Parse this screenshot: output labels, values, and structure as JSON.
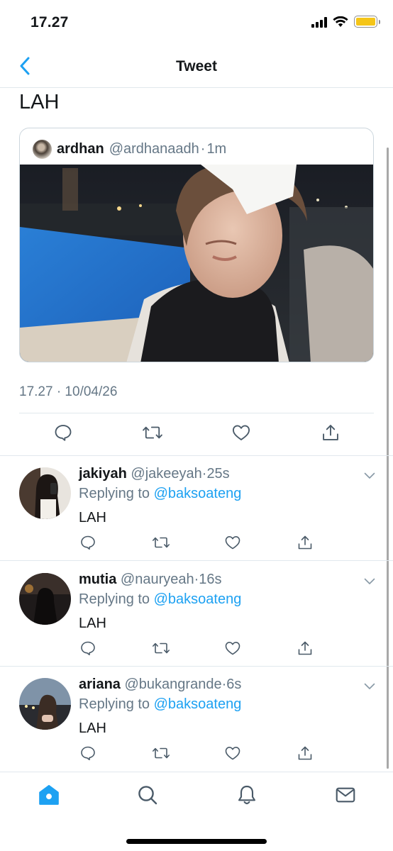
{
  "status_bar": {
    "time": "17.27"
  },
  "nav": {
    "title": "Tweet"
  },
  "tweet": {
    "text": "LAH",
    "quoted": {
      "name": "ardhan",
      "handle": "@ardhanaadh",
      "separator": "·",
      "time": "1m"
    },
    "timestamp": "17.27 · 10/04/26"
  },
  "icons": {
    "reply": "reply-icon",
    "retweet": "retweet-icon",
    "like": "heart-icon",
    "share": "share-icon"
  },
  "replies": [
    {
      "name": "jakiyah",
      "handle": "@jakeeyah",
      "separator": "·",
      "time": "25s",
      "replying_prefix": "Replying to ",
      "replying_to": "@baksoateng",
      "text": "LAH"
    },
    {
      "name": "mutia",
      "handle": "@nauryeah",
      "separator": "·",
      "time": "16s",
      "replying_prefix": "Replying to ",
      "replying_to": "@baksoateng",
      "text": "LAH"
    },
    {
      "name": "ariana",
      "handle": "@bukangrande",
      "separator": "·",
      "time": "6s",
      "replying_prefix": "Replying to ",
      "replying_to": "@baksoateng",
      "text": "LAH"
    }
  ],
  "tab_bar": {
    "tabs": [
      "home-icon",
      "search-icon",
      "notifications-icon",
      "messages-icon"
    ],
    "active": "home-icon"
  },
  "colors": {
    "accent": "#1da1f2",
    "secondary_text": "#657786",
    "battery": "#f5c518"
  }
}
